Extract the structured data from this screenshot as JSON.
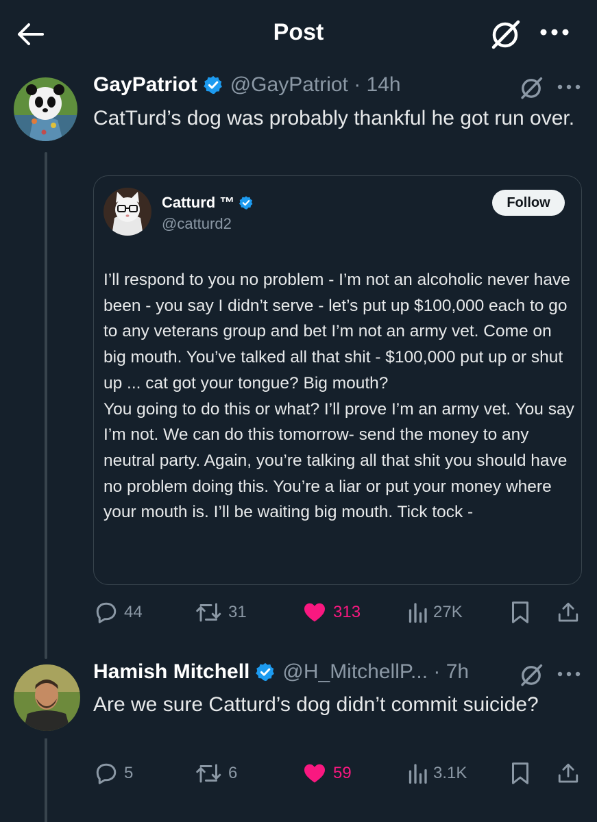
{
  "header": {
    "title": "Post"
  },
  "post": {
    "author_name": "GayPatriot",
    "handle_time": "@GayPatriot · 14h",
    "text": "CatTurd’s dog was probably thankful he got run over.",
    "quote": {
      "author_name": "Catturd ™",
      "handle": "@catturd2",
      "follow_label": "Follow",
      "text": "I’ll respond to you no problem - I’m not an alcoholic never have been - you say I didn’t serve - let’s put up $100,000 each to go to any veterans group and bet I’m not an army vet. Come on big mouth. You’ve talked all that shit - $100,000 put up or shut up ... cat got your tongue? Big mouth?\nYou going to do this or what? I’ll prove I’m an army vet. You say I’m not. We can do this tomorrow- send the money to any neutral party. Again, you’re talking all that shit you should have no problem doing this. You’re a liar or put your money where your mouth is.  I’ll be waiting big mouth. Tick tock -"
    },
    "actions": {
      "replies": "44",
      "reposts": "31",
      "likes": "313",
      "views": "27K"
    }
  },
  "reply": {
    "author_name": "Hamish Mitchell",
    "handle_time": "@H_MitchellP... · 7h",
    "text": "Are we sure Catturd’s dog didn’t commit suicide?",
    "actions": {
      "replies": "5",
      "reposts": "6",
      "likes": "59",
      "views": "3.1K"
    }
  },
  "colors": {
    "background": "#15202b",
    "like": "#f91880",
    "verified": "#1d9bf0",
    "muted": "#8b98a5"
  }
}
